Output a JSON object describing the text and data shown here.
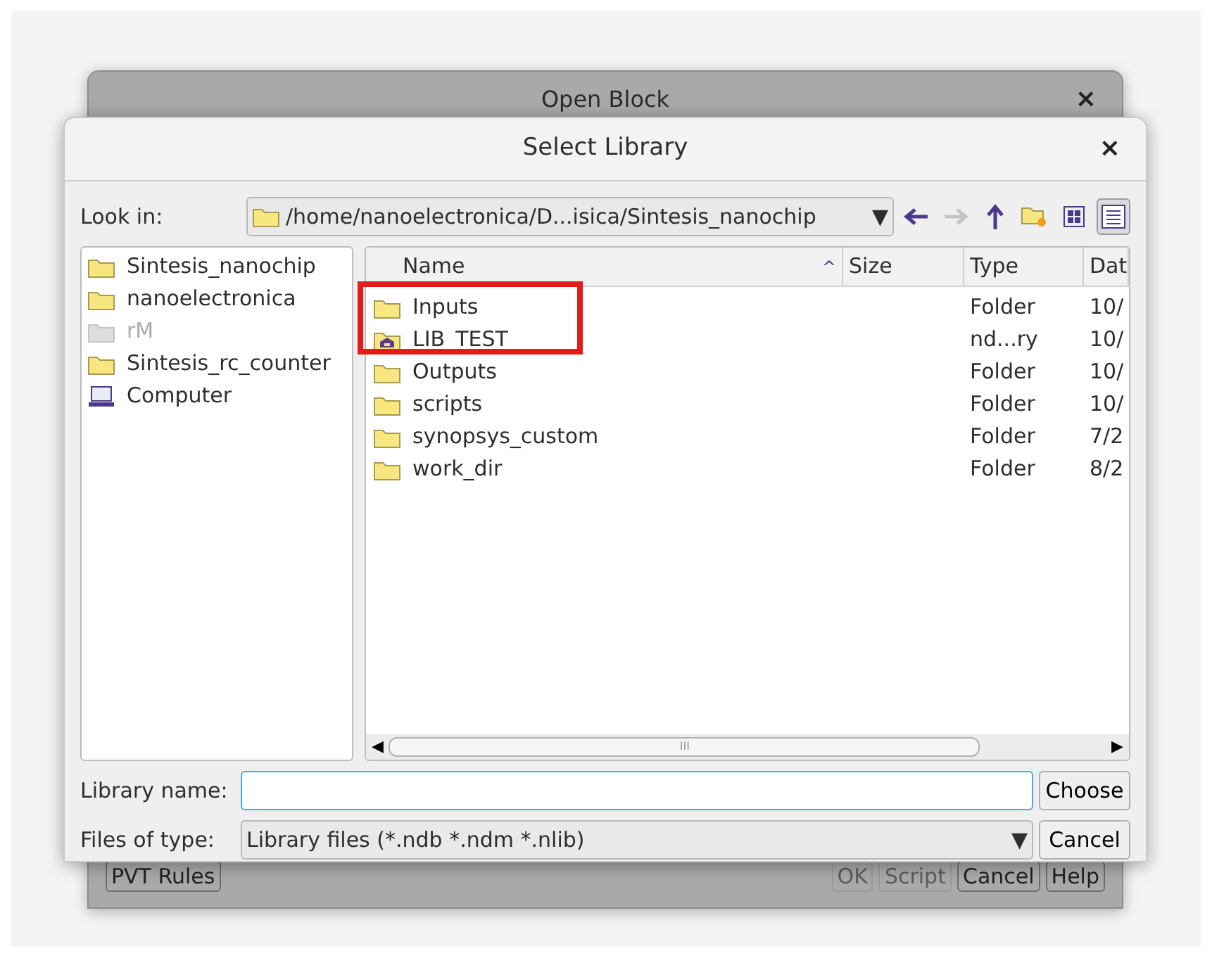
{
  "back_window": {
    "title": "Open Block",
    "close": "×",
    "buttons": [
      {
        "label": "PVT Rules",
        "disabled": false
      },
      {
        "label": "OK",
        "disabled": true
      },
      {
        "label": "Script",
        "disabled": true
      },
      {
        "label": "Cancel",
        "disabled": false
      },
      {
        "label": "Help",
        "disabled": false
      }
    ]
  },
  "dialog": {
    "title": "Select Library",
    "close": "×",
    "look_in": {
      "label": "Look in:",
      "value": "/home/nanoelectronica/D...isica/Sintesis_nanochip",
      "arrow": "▼"
    },
    "toolbar": [
      {
        "kind": "back",
        "disabled": false,
        "selected": false
      },
      {
        "kind": "forward",
        "disabled": true,
        "selected": false
      },
      {
        "kind": "up",
        "disabled": false,
        "selected": false
      },
      {
        "kind": "new-folder",
        "disabled": false,
        "selected": false
      },
      {
        "kind": "icons",
        "disabled": false,
        "selected": false
      },
      {
        "kind": "details",
        "disabled": false,
        "selected": true
      }
    ],
    "sidebar": [
      {
        "kind": "folder",
        "label": "Sintesis_nanochip",
        "disabled": false
      },
      {
        "kind": "folder",
        "label": "nanoelectronica",
        "disabled": false
      },
      {
        "kind": "folder",
        "label": "rM",
        "disabled": true
      },
      {
        "kind": "folder",
        "label": "Sintesis_rc_counter",
        "disabled": false
      },
      {
        "kind": "computer",
        "label": "Computer",
        "disabled": false
      }
    ],
    "table": {
      "columns": [
        {
          "label": "Name",
          "sorted": true
        },
        {
          "label": "Size",
          "sorted": false
        },
        {
          "label": "Type",
          "sorted": false
        },
        {
          "label": "Dat",
          "sorted": false
        }
      ],
      "sort_arrow": "^",
      "rows": [
        {
          "kind": "folder",
          "name": "Inputs",
          "type": "Folder",
          "date": "10/"
        },
        {
          "kind": "library",
          "name": "LIB_TEST",
          "type": "nd...ry",
          "date": "10/"
        },
        {
          "kind": "folder",
          "name": "Outputs",
          "type": "Folder",
          "date": "10/"
        },
        {
          "kind": "folder",
          "name": "scripts",
          "type": "Folder",
          "date": "10/"
        },
        {
          "kind": "folder",
          "name": "synopsys_custom",
          "type": "Folder",
          "date": "7/2"
        },
        {
          "kind": "folder",
          "name": "work_dir",
          "type": "Folder",
          "date": "8/2"
        }
      ],
      "scroll_left": "◀",
      "scroll_right": "▶",
      "scroll_grip": "III"
    },
    "library_name": {
      "label": "Library name:"
    },
    "files_of_type": {
      "label": "Files of type:",
      "value": "Library files (*.ndb *.ndm *.nlib)",
      "arrow": "▼"
    },
    "buttons": [
      "Choose",
      "Cancel"
    ]
  },
  "annotation": {
    "kind": "rectangle",
    "color": "#e21b1b"
  }
}
